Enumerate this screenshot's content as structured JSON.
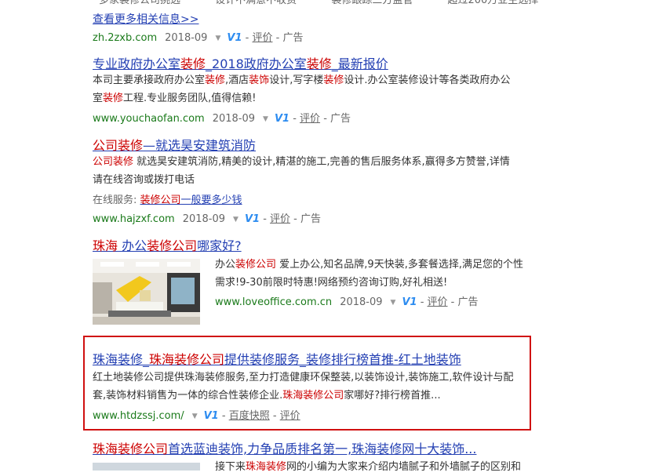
{
  "top_partial": {
    "snippets": [
      "多家装修公司挑选",
      "设计不满意不收费",
      "装修跟踪三方监管",
      "超过200万业主选择"
    ],
    "more_link": "查看更多相关信息>>",
    "url": "zh.2zxb.com",
    "date": "2018-09",
    "v_badge": "V1",
    "rate": "评价",
    "ad": "广告"
  },
  "results": [
    {
      "title_parts": [
        {
          "t": "专业政府办公室",
          "hl": false
        },
        {
          "t": "装修",
          "hl": true
        },
        {
          "t": "_2018政府办公室",
          "hl": false
        },
        {
          "t": "装修",
          "hl": true
        },
        {
          "t": "_最新报价",
          "hl": false
        }
      ],
      "desc_line1": [
        {
          "t": "本司主要承接政府办公室",
          "hl": false
        },
        {
          "t": "装修",
          "hl": true
        },
        {
          "t": ",酒店",
          "hl": false
        },
        {
          "t": "装饰",
          "hl": true
        },
        {
          "t": "设计,写字楼",
          "hl": false
        },
        {
          "t": "装修",
          "hl": true
        },
        {
          "t": "设计.办公室装修设计等各类政府办公",
          "hl": false
        }
      ],
      "desc_line2": [
        {
          "t": "室",
          "hl": false
        },
        {
          "t": "装修",
          "hl": true
        },
        {
          "t": "工程.专业服务团队,值得信赖!",
          "hl": false
        }
      ],
      "url": "www.youchaofan.com",
      "date": "2018-09",
      "v_badge": "V1",
      "rate": "评价",
      "ad": "广告"
    },
    {
      "title_parts": [
        {
          "t": "公司",
          "hl": true
        },
        {
          "t": "装修",
          "hl": true
        },
        {
          "t": "—就选昊安建筑消防",
          "hl": false
        }
      ],
      "desc_line1": [
        {
          "t": "公司",
          "hl": true
        },
        {
          "t": "装修",
          "hl": true
        },
        {
          "t": " 就选昊安建筑消防,精美的设计,精湛的施工,完善的售后服务体系,赢得多方赞誉,详情",
          "hl": false
        }
      ],
      "desc_line2": [
        {
          "t": "请在线咨询或拨打电话",
          "hl": false
        }
      ],
      "service_label": "在线服务:",
      "service_link_parts": [
        {
          "t": "装修公司",
          "hl": true
        },
        {
          "t": "一般要多少钱",
          "hl": false
        }
      ],
      "url": "www.hajzxf.com",
      "date": "2018-09",
      "v_badge": "V1",
      "rate": "评价",
      "ad": "广告"
    },
    {
      "title_parts": [
        {
          "t": "珠海",
          "hl": true
        },
        {
          "t": " 办公",
          "hl": false
        },
        {
          "t": "装修公司",
          "hl": true
        },
        {
          "t": "哪家好?",
          "hl": false
        }
      ],
      "desc_line1": [
        {
          "t": "办公",
          "hl": false
        },
        {
          "t": "装修公司",
          "hl": true
        },
        {
          "t": " 爱上办公,知名品牌,9天快装,多套餐选择,满足您的个性",
          "hl": false
        }
      ],
      "desc_line2": [
        {
          "t": "需求!9-30前限时特惠!网络预约咨询订购,好礼相送!",
          "hl": false
        }
      ],
      "url": "www.loveoffice.com.cn",
      "date": "2018-09",
      "v_badge": "V1",
      "rate": "评价",
      "ad": "广告"
    },
    {
      "title_parts": [
        {
          "t": "珠海装修",
          "hl": false
        },
        {
          "t": "_",
          "hl": false
        },
        {
          "t": "珠海装修公司",
          "hl": true
        },
        {
          "t": "提供装修服务_装修排行榜首推-红土地装饰",
          "hl": false
        }
      ],
      "desc_line1": [
        {
          "t": "红土地装修公司提供珠海装修服务,至力打造健康环保整装,以装饰设计,装饰施工,软件设计与配",
          "hl": false
        }
      ],
      "desc_line2": [
        {
          "t": "套,装饰材料销售为一体的综合性装修企业.",
          "hl": false
        },
        {
          "t": "珠海装修公司",
          "hl": true
        },
        {
          "t": "家哪好?排行榜首推...",
          "hl": false
        }
      ],
      "url": "www.htdzssj.com/",
      "v_badge": "V1",
      "snapshot": "百度快照",
      "rate": "评价"
    },
    {
      "title_parts": [
        {
          "t": "珠海装修公司",
          "hl": true
        },
        {
          "t": "首选蓝迪装饰,力争品质排名第一,珠海装修网十大装饰...",
          "hl": false
        }
      ],
      "desc_line1": [
        {
          "t": "接下来",
          "hl": false
        },
        {
          "t": "珠海装修",
          "hl": true
        },
        {
          "t": "网的小编为大家来介绍内墙腻子和外墙腻子的区别和",
          "hl": false
        }
      ]
    }
  ],
  "colors": {
    "link": "#2440b3",
    "highlight": "#c00000",
    "url": "#1a7a1a",
    "box": "#d01010"
  },
  "icons": [
    "dropdown-triangle-icon",
    "v1-verified-icon"
  ]
}
